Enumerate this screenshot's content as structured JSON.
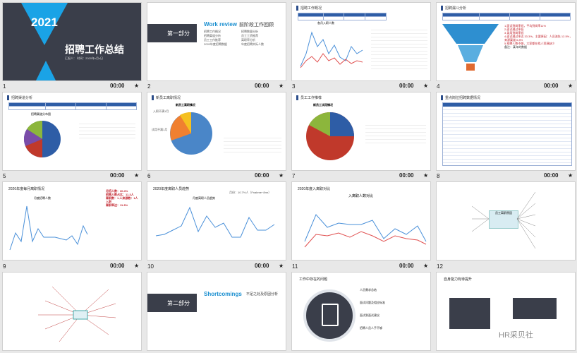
{
  "slides": [
    {
      "n": "1",
      "time": "00:00",
      "title_year": "2021",
      "title": "招聘工作总结",
      "sub": "汇报人：        时间：2020年x月x日"
    },
    {
      "n": "2",
      "time": "00:00",
      "part": "第一部分",
      "en": "Work review",
      "cn": "前阶段工作回顾",
      "items": [
        "招聘工作概况",
        "招聘渠道分析",
        "员工工作推荐",
        "2020年度招聘数据",
        "招聘数量分析",
        "员工工资推荐",
        "离职率分析",
        "年度招聘实际人数"
      ]
    },
    {
      "n": "3",
      "time": "00:00",
      "title": "招聘工作概况",
      "chart_title": "各月入职人数"
    },
    {
      "n": "4",
      "time": "00:00",
      "title": "招聘漏斗分析",
      "notes": [
        "1.面试到岗率低，平均到岗率11%",
        "2.面试通过率低",
        "3.录用到岗率低",
        "4.面试通过率达 33.3%，主要原因：人员流失 12.5%，来源渠道 6.8%",
        "5.招聘人数不够，大家都在找人资源缺少",
        "备注：某年的数据"
      ]
    },
    {
      "n": "5",
      "time": "00:00",
      "title": "招聘渠道分析",
      "chart_title": "招聘渠道分布图"
    },
    {
      "n": "6",
      "time": "00:00",
      "title": "新员工离职情况",
      "chart_title": "新员工离职情况",
      "labels": [
        "入职不满1月",
        "试用不满1月",
        "满1年",
        "1年以上"
      ]
    },
    {
      "n": "7",
      "time": "00:00",
      "title": "员工工作推荐",
      "chart_title": "新员工试用情况"
    },
    {
      "n": "8",
      "time": "00:00",
      "title": "重点岗位招聘数据情况"
    },
    {
      "n": "9",
      "time": "00:00",
      "title": "2020年度每月离职情况",
      "chart_title": "月度招聘人数",
      "notes": [
        "月招人数：30.4%",
        "招聘人数占比：11.3人",
        "离职数：1.人来源数：1人入职",
        "离职率达：11.3%"
      ]
    },
    {
      "n": "10",
      "time": "00:00",
      "title": "2020年度离职人员趋势",
      "chart_title": "月度离职人员趋势",
      "note": "月份：10.7%人（Fnabme~8mr）"
    },
    {
      "n": "11",
      "time": "00:00",
      "title": "2020年度入离职对比",
      "chart_title": "入离职人数对比"
    },
    {
      "n": "12",
      "time": "",
      "title": "员工离职原因"
    },
    {
      "n": "",
      "time": "",
      "title": "思维导图"
    },
    {
      "n": "",
      "time": "",
      "part": "第二部分",
      "en": "Shortcomings",
      "cn": "不足之处及原因分析"
    },
    {
      "n": "",
      "time": "",
      "title": "工作中存在的问题",
      "items": [
        "人员需求总结",
        "面试问题及相应标准",
        "面试到面试建议",
        "招聘人员人手不够"
      ]
    },
    {
      "n": "",
      "time": "",
      "title": "自身能力有待提升",
      "watermark": "HR采贝社"
    }
  ]
}
